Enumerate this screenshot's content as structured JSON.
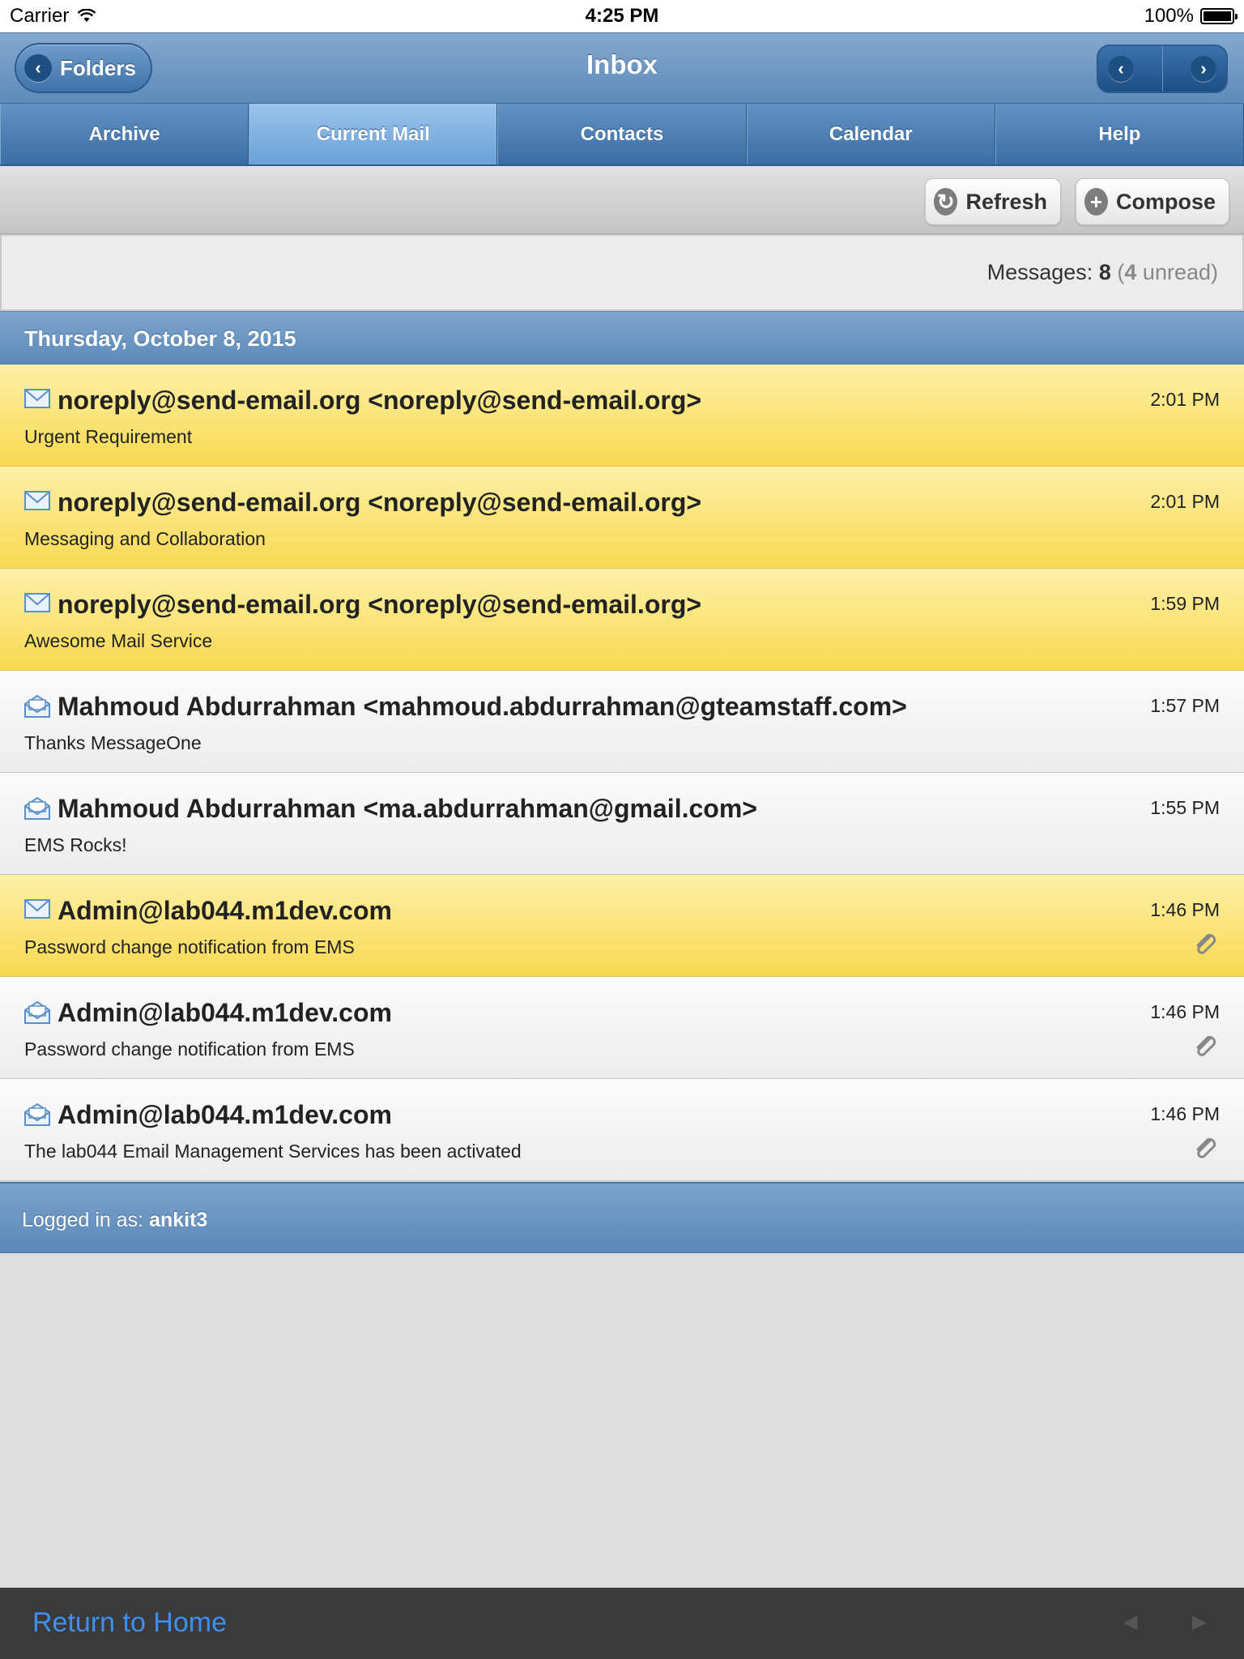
{
  "status_bar": {
    "carrier": "Carrier",
    "time": "4:25 PM",
    "battery": "100%"
  },
  "header": {
    "title": "Inbox",
    "back_label": "Folders"
  },
  "tabs": [
    {
      "label": "Archive",
      "active": false
    },
    {
      "label": "Current Mail",
      "active": true
    },
    {
      "label": "Contacts",
      "active": false
    },
    {
      "label": "Calendar",
      "active": false
    },
    {
      "label": "Help",
      "active": false
    }
  ],
  "toolbar": {
    "refresh_label": "Refresh",
    "compose_label": "Compose"
  },
  "summary": {
    "prefix": "Messages:",
    "total": "8",
    "unread_count": "4",
    "unread_word": "unread"
  },
  "date_group": "Thursday, October 8, 2015",
  "messages": [
    {
      "sender": "noreply@send-email.org <noreply@send-email.org>",
      "subject": "Urgent Requirement",
      "time": "2:01 PM",
      "unread": true,
      "attachment": false
    },
    {
      "sender": "noreply@send-email.org <noreply@send-email.org>",
      "subject": "Messaging and Collaboration",
      "time": "2:01 PM",
      "unread": true,
      "attachment": false
    },
    {
      "sender": "noreply@send-email.org <noreply@send-email.org>",
      "subject": "Awesome Mail Service",
      "time": "1:59 PM",
      "unread": true,
      "attachment": false
    },
    {
      "sender": "Mahmoud Abdurrahman <mahmoud.abdurrahman@gteamstaff.com>",
      "subject": "Thanks MessageOne",
      "time": "1:57 PM",
      "unread": false,
      "attachment": false
    },
    {
      "sender": "Mahmoud Abdurrahman <ma.abdurrahman@gmail.com>",
      "subject": "EMS Rocks!",
      "time": "1:55 PM",
      "unread": false,
      "attachment": false
    },
    {
      "sender": "Admin@lab044.m1dev.com",
      "subject": "Password change notification from EMS",
      "time": "1:46 PM",
      "unread": true,
      "attachment": true
    },
    {
      "sender": "Admin@lab044.m1dev.com",
      "subject": "Password change notification from EMS",
      "time": "1:46 PM",
      "unread": false,
      "attachment": true
    },
    {
      "sender": "Admin@lab044.m1dev.com",
      "subject": "The lab044 Email Management Services has been activated",
      "time": "1:46 PM",
      "unread": false,
      "attachment": true
    }
  ],
  "login": {
    "prefix": "Logged in as:",
    "user": "ankit3"
  },
  "bottom_bar": {
    "home_label": "Return to Home",
    "prev_arrow": "◄",
    "next_arrow": "►"
  },
  "colors": {
    "header_blue": "#5e89b9",
    "unread_yellow": "#f8d950",
    "link_blue": "#3f8ff0"
  },
  "icons": {
    "unread": "envelope-closed-icon",
    "read": "envelope-open-icon",
    "attachment": "paperclip-icon"
  }
}
